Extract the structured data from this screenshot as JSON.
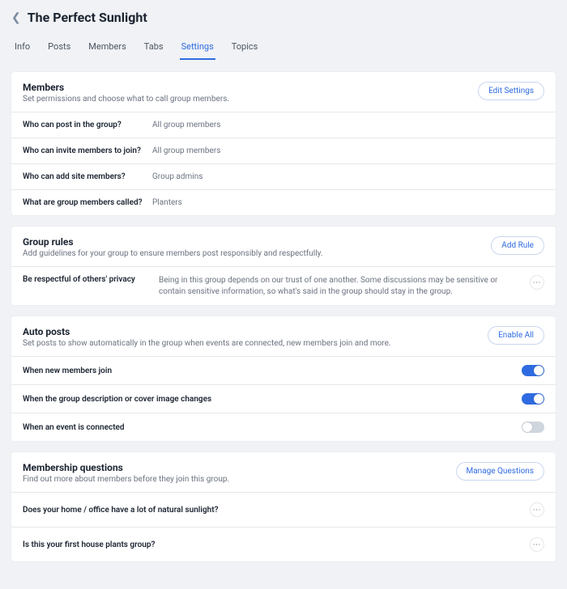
{
  "header": {
    "title": "The Perfect Sunlight"
  },
  "tabs": [
    "Info",
    "Posts",
    "Members",
    "Tabs",
    "Settings",
    "Topics"
  ],
  "activeTab": "Settings",
  "members": {
    "title": "Members",
    "subtitle": "Set permissions and choose what to call group members.",
    "button": "Edit Settings",
    "rows": [
      {
        "label": "Who can post in the group?",
        "value": "All group members"
      },
      {
        "label": "Who can invite members to join?",
        "value": "All group members"
      },
      {
        "label": "Who can add site members?",
        "value": "Group admins"
      },
      {
        "label": "What are group members called?",
        "value": "Planters"
      }
    ]
  },
  "rules": {
    "title": "Group rules",
    "subtitle": "Add guidelines for your group to ensure members post responsibly and respectfully.",
    "button": "Add Rule",
    "items": [
      {
        "title": "Be respectful of others' privacy",
        "body": "Being in this group depends on our trust of one another. Some discussions may be sensitive or contain sensitive information, so what's said in the group should stay in the group."
      }
    ]
  },
  "autoposts": {
    "title": "Auto posts",
    "subtitle": "Set posts to show automatically in the group when events are connected, new members join and more.",
    "button": "Enable All",
    "items": [
      {
        "label": "When new members join",
        "on": true
      },
      {
        "label": "When the group description or cover image changes",
        "on": true
      },
      {
        "label": "When an event is connected",
        "on": false
      }
    ]
  },
  "questions": {
    "title": "Membership questions",
    "subtitle": "Find out more about members before they join this group.",
    "button": "Manage Questions",
    "items": [
      "Does your home / office have a lot of natural sunlight?",
      "Is this your first house plants group?"
    ]
  },
  "icons": {
    "more": "⋯"
  }
}
